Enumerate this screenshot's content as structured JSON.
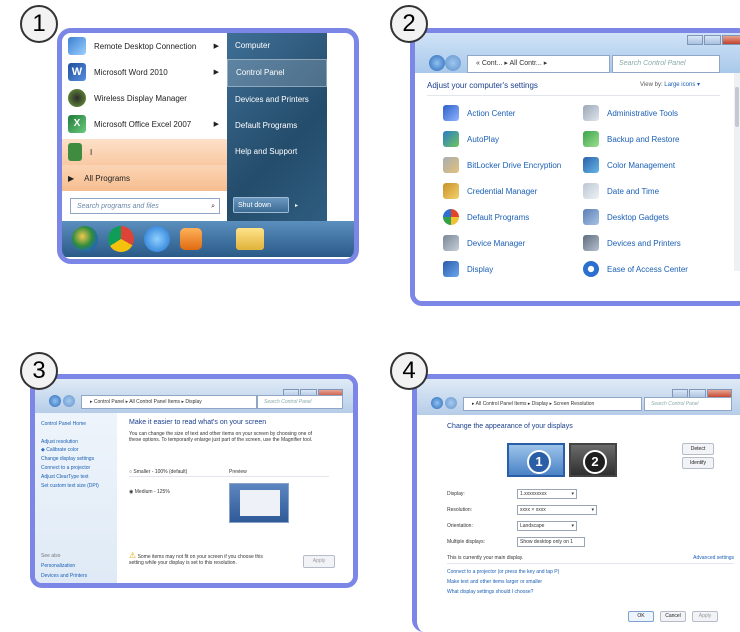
{
  "badges": [
    "1",
    "2",
    "3",
    "4"
  ],
  "panel1": {
    "left_items": [
      {
        "label": "Remote Desktop Connection",
        "icon": "remote-desktop-icon",
        "arrow": "▶"
      },
      {
        "label": "Microsoft Word 2010",
        "icon": "word-icon",
        "arrow": "▶"
      },
      {
        "label": "Wireless Display Manager",
        "icon": "wireless-display-icon",
        "arrow": ""
      },
      {
        "label": "Microsoft Office Excel 2007",
        "icon": "excel-icon",
        "arrow": "▶"
      },
      {
        "label": "I",
        "icon": "app-icon",
        "arrow": ""
      }
    ],
    "all_programs": "All Programs",
    "search_placeholder": "Search programs and files",
    "right_items": [
      "Computer",
      "Control Panel",
      "Devices and Printers",
      "Default Programs",
      "Help and Support"
    ],
    "shutdown": "Shut down",
    "colors": {
      "accent": "#7b86e6",
      "highlight": "#f9c9a3"
    }
  },
  "panel2": {
    "address": "« Cont... ▸ All Contr... ▸",
    "search": "Search Control Panel",
    "heading": "Adjust your computer's settings",
    "viewby": "View by:",
    "viewby_value": "Large icons ▾",
    "items": [
      [
        "Action Center",
        "Administrative Tools"
      ],
      [
        "AutoPlay",
        "Backup and Restore"
      ],
      [
        "BitLocker Drive Encryption",
        "Color Management"
      ],
      [
        "Credential Manager",
        "Date and Time"
      ],
      [
        "Default Programs",
        "Desktop Gadgets"
      ],
      [
        "Device Manager",
        "Devices and Printers"
      ],
      [
        "Display",
        "Ease of Access Center"
      ]
    ]
  },
  "panel3": {
    "address": "▸ Control Panel ▸ All Control Panel Items ▸ Display",
    "search": "Search Control Panel",
    "sidebar": [
      "Control Panel Home",
      "Adjust resolution",
      "Calibrate color",
      "Change display settings",
      "Connect to a projector",
      "Adjust ClearType text",
      "Set custom text size (DPI)"
    ],
    "see_also": "See also",
    "see_also_items": [
      "Personalization",
      "Devices and Printers"
    ],
    "title": "Make it easier to read what's on your screen",
    "desc": "You can change the size of text and other items on your screen by choosing one of these options. To temporarily enlarge just part of the screen, use the Magnifier tool.",
    "option_smaller": "Smaller - 100% (default)",
    "preview": "Preview",
    "option_medium": "Medium - 125%",
    "warning": "Some items may not fit on your screen if you choose this setting while your display is set to this resolution.",
    "apply": "Apply"
  },
  "panel4": {
    "address": "▸ All Control Panel Items ▸ Display ▸ Screen Resolution",
    "search": "Search Control Panel",
    "title": "Change the appearance of your displays",
    "detect": "Detect",
    "identify": "Identify",
    "monitor1": "1",
    "monitor2": "2",
    "fields": [
      {
        "label": "Display:",
        "value": "1.xxxxxxxxx"
      },
      {
        "label": "Resolution:",
        "value": "xxxx × xxxx"
      },
      {
        "label": "Orientation:",
        "value": "Landscape"
      },
      {
        "label": "Multiple displays:",
        "value": "Show desktop only on 1"
      }
    ],
    "main_display": "This is currently your main display.",
    "advanced": "Advanced settings",
    "link1": "Connect to a projector (or press the  key and tap P)",
    "link2": "Make text and other items larger or smaller",
    "link3": "What display settings should I choose?",
    "ok": "OK",
    "cancel": "Cancel",
    "apply": "Apply"
  }
}
